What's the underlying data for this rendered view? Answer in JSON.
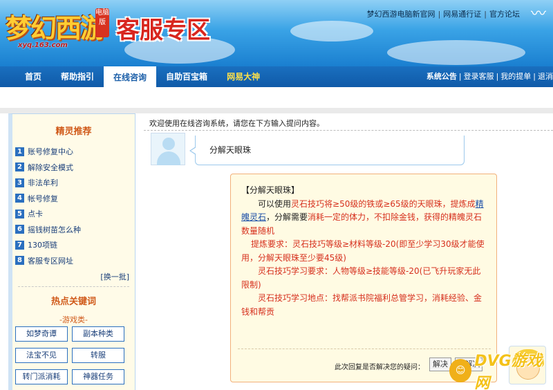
{
  "header": {
    "logo_text": "梦幻西游",
    "logo_badge": "电脑版",
    "logo_url": "xyq.163.com",
    "site_title": "客服专区",
    "toplinks": [
      "梦幻西游电脑新官网",
      "网易通行证",
      "官方论坛"
    ]
  },
  "nav": {
    "items": [
      "首页",
      "帮助指引",
      "在线咨询",
      "自助百宝箱",
      "网易大神"
    ],
    "active": "在线咨询",
    "right": [
      "系统公告",
      "登录客服",
      "我的提单",
      "退消"
    ]
  },
  "sidebar": {
    "title": "精灵推荐",
    "items": [
      {
        "num": "1",
        "label": "账号修复中心"
      },
      {
        "num": "2",
        "label": "解除安全模式"
      },
      {
        "num": "3",
        "label": "非法牟利"
      },
      {
        "num": "4",
        "label": "帐号修复"
      },
      {
        "num": "5",
        "label": "点卡"
      },
      {
        "num": "6",
        "label": "摇钱树苗怎么种"
      },
      {
        "num": "7",
        "label": "130项链"
      },
      {
        "num": "8",
        "label": "客服专区网址"
      }
    ],
    "more": "[换一批]",
    "hot_title": "热点关键词",
    "hot_sub": "-游戏类-",
    "keywords": [
      "如梦奇谭",
      "副本种类",
      "法宝不见",
      "转服",
      "转门派消耗",
      "神器任务"
    ]
  },
  "main": {
    "welcome": "欢迎使用在线咨询系统，请您在下方输入提问内容。",
    "question": "分解天眼珠",
    "answer": {
      "title": "【分解天眼珠】",
      "p1_a": "可以使用",
      "p1_b": "灵石技巧将≥50级的铁或≥65级的天眼珠，提炼成",
      "p1_link": "精魄灵石",
      "p1_c": "，分解需要",
      "p1_d": "消耗一定的体力，不扣除金钱，获得的精魄灵石数量随机",
      "p2": "提炼要求：灵石技巧等级≥材料等级-20(即至少学习30级才能使用，分解天眼珠至少要45级)",
      "p3": "灵石技巧学习要求：人物等级≥技能等级-20(已飞升玩家无此限制)",
      "p4": "灵石技巧学习地点：找帮派书院福利总管学习，消耗经验、金钱和帮贡"
    },
    "resolve_question": "此次回复是否解决您的疑问：",
    "solved": "解决",
    "unsolved": "未解决"
  },
  "watermark": {
    "icon": "😊",
    "text": "DVG游戏网"
  },
  "colors": {
    "accent": "#1a6fbf",
    "highlight": "#d6301e",
    "title_orange": "#d05a1a"
  }
}
